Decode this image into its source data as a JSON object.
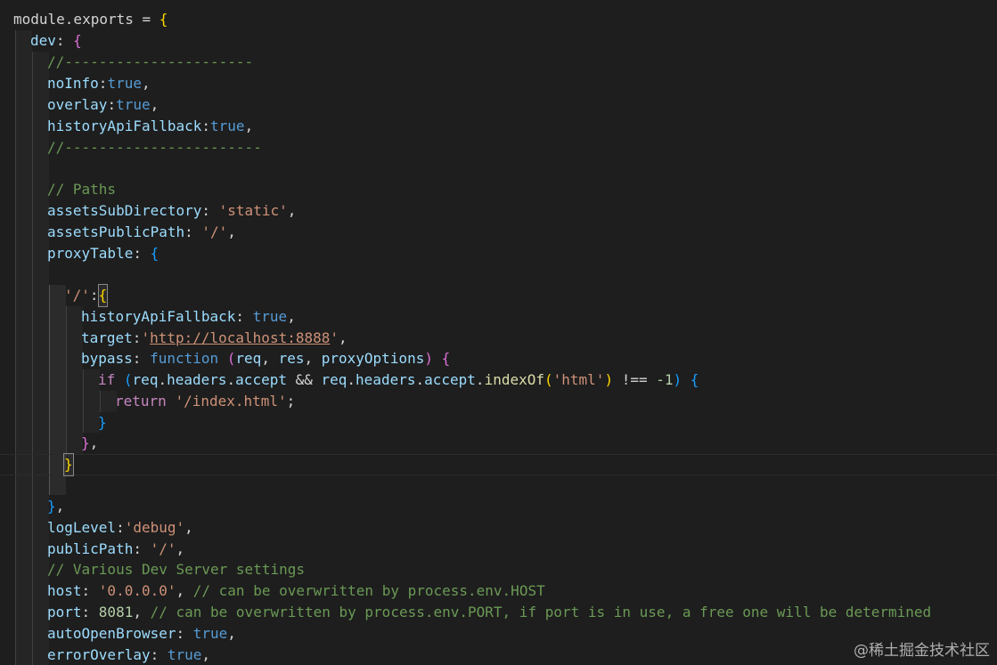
{
  "editor": {
    "colors": {
      "background": "#1e1e1e",
      "property": "#9cdcfe",
      "keyword": "#569cd6",
      "control": "#c586c0",
      "string": "#ce9178",
      "comment": "#6a9955",
      "number": "#b5cea8",
      "function": "#dcdcaa",
      "bracket_level_1": "#ffd700",
      "bracket_level_2": "#da70d6",
      "bracket_level_3": "#179fff"
    },
    "lines": [
      {
        "id": "l1",
        "tokens": [
          "module.exports = ",
          "{"
        ]
      },
      {
        "id": "l2",
        "tokens": [
          "dev",
          ": ",
          "{"
        ]
      },
      {
        "id": "l3",
        "tokens": [
          "//----------------------"
        ]
      },
      {
        "id": "l4",
        "tokens": [
          "noInfo",
          ":",
          "true",
          ","
        ]
      },
      {
        "id": "l5",
        "tokens": [
          "overlay",
          ":",
          "true",
          ","
        ]
      },
      {
        "id": "l6",
        "tokens": [
          "historyApiFallback",
          ":",
          "true",
          ","
        ]
      },
      {
        "id": "l7",
        "tokens": [
          "//-----------------------"
        ]
      },
      {
        "id": "l9",
        "tokens": [
          "// Paths"
        ]
      },
      {
        "id": "l10",
        "tokens": [
          "assetsSubDirectory",
          ": ",
          "'static'",
          ","
        ]
      },
      {
        "id": "l11",
        "tokens": [
          "assetsPublicPath",
          ": ",
          "'/'",
          ","
        ]
      },
      {
        "id": "l12",
        "tokens": [
          "proxyTable",
          ": ",
          "{"
        ]
      },
      {
        "id": "l14",
        "tokens": [
          "'/'",
          ":",
          "{"
        ]
      },
      {
        "id": "l15",
        "tokens": [
          "historyApiFallback",
          ": ",
          "true",
          ","
        ]
      },
      {
        "id": "l16",
        "tokens": [
          "target",
          ":",
          "'",
          "http://localhost:8888",
          "'",
          ","
        ]
      },
      {
        "id": "l17",
        "tokens": [
          "bypass",
          ": ",
          "function",
          " ",
          "(",
          "req",
          ", ",
          "res",
          ", ",
          "proxyOptions",
          ")",
          " ",
          "{"
        ]
      },
      {
        "id": "l18",
        "tokens": [
          "if",
          " ",
          "(",
          "req",
          ".",
          "headers",
          ".",
          "accept",
          " && ",
          "req",
          ".",
          "headers",
          ".",
          "accept",
          ".",
          "indexOf",
          "(",
          "'html'",
          ")",
          " !== ",
          "-1",
          ")",
          " ",
          "{"
        ]
      },
      {
        "id": "l19",
        "tokens": [
          "return",
          " ",
          "'/index.html'",
          ";"
        ]
      },
      {
        "id": "l20",
        "tokens": [
          "}"
        ]
      },
      {
        "id": "l21",
        "tokens": [
          "}",
          ","
        ]
      },
      {
        "id": "l22",
        "tokens": [
          "}"
        ]
      },
      {
        "id": "l24",
        "tokens": [
          "}",
          ","
        ]
      },
      {
        "id": "l25",
        "tokens": [
          "logLevel",
          ":",
          "'debug'",
          ","
        ]
      },
      {
        "id": "l26",
        "tokens": [
          "publicPath",
          ": ",
          "'/'",
          ","
        ]
      },
      {
        "id": "l27",
        "tokens": [
          "// Various Dev Server settings"
        ]
      },
      {
        "id": "l28",
        "tokens": [
          "host",
          ": ",
          "'0.0.0.0'",
          ", ",
          "// can be overwritten by process.env.HOST"
        ]
      },
      {
        "id": "l29",
        "tokens": [
          "port",
          ": ",
          "8081",
          ", ",
          "// can be overwritten by process.env.PORT, if port is in use, a free one will be determined"
        ]
      },
      {
        "id": "l30",
        "tokens": [
          "autoOpenBrowser",
          ": ",
          "true",
          ","
        ]
      },
      {
        "id": "l31",
        "tokens": [
          "errorOverlay",
          ": ",
          "true",
          ","
        ]
      }
    ]
  },
  "watermark": {
    "text": "@稀土掘金技术社区"
  }
}
